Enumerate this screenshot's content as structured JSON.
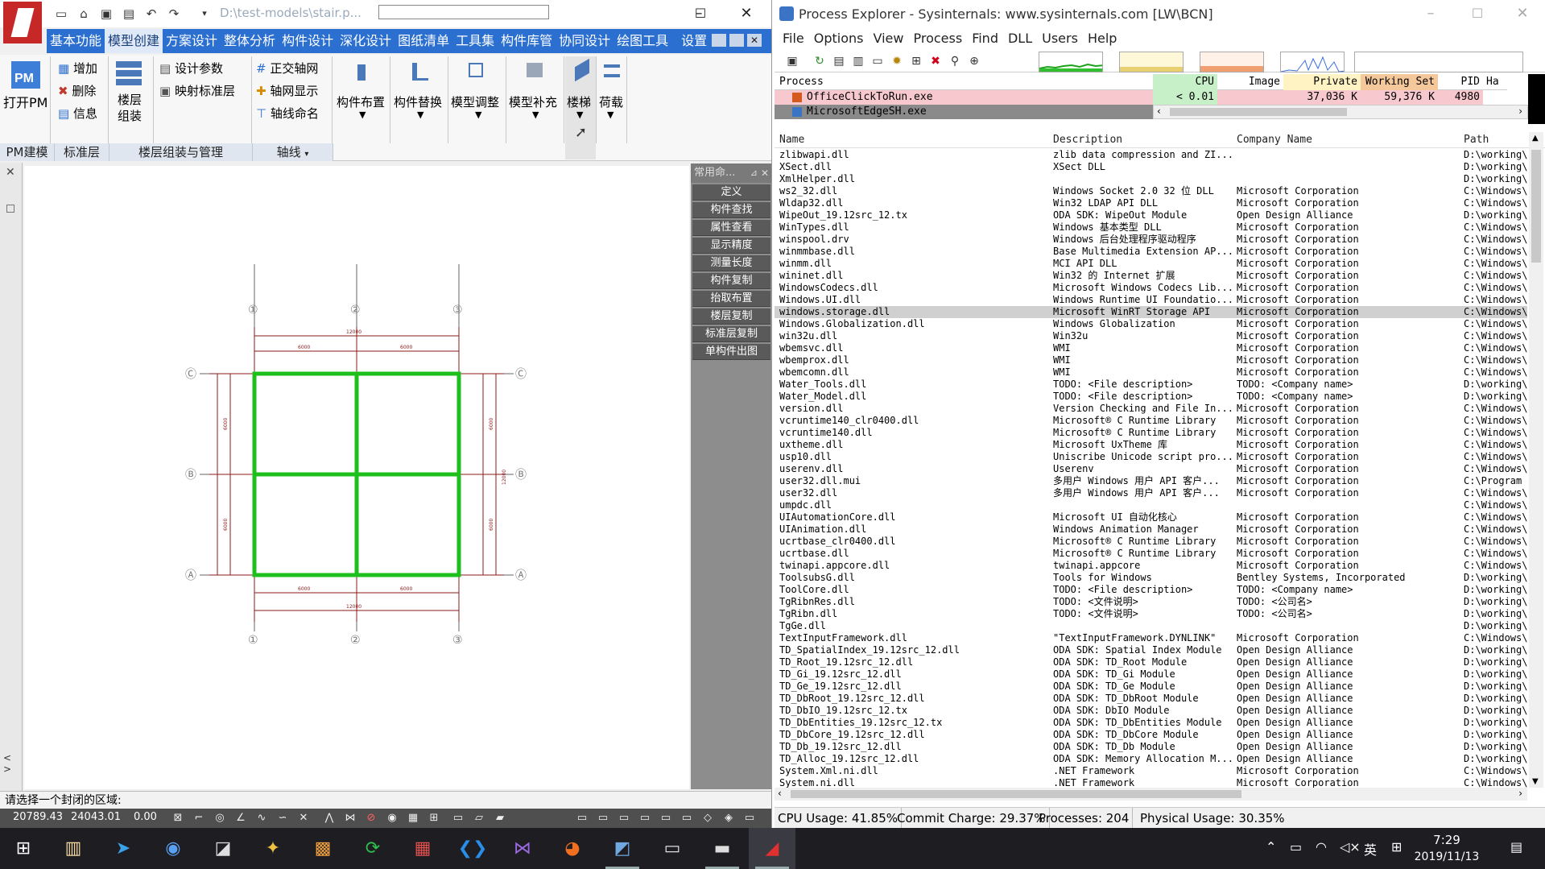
{
  "cad": {
    "path": "D:\\test-models\\stair.p...",
    "menu": [
      "基本功能",
      "模型创建",
      "方案设计",
      "整体分析",
      "构件设计",
      "深化设计",
      "图纸清单",
      "工具集",
      "构件库管",
      "协同设计",
      "绘图工具",
      "设置"
    ],
    "ribbon": {
      "open_pm": "打开PM",
      "add": "增加",
      "delete": "删除",
      "info": "信息",
      "floor_assembly": "楼层组装",
      "design_params": "设计参数",
      "map_standard_floor": "映射标准层",
      "ortho_grid": "正交轴网",
      "grid_display": "轴网显示",
      "grid_naming": "轴线命名",
      "member_layout": "构件布置",
      "member_replace": "构件替换",
      "model_adjust": "模型调整",
      "model_supplement": "模型补充",
      "stairs": "楼梯",
      "load": "荷载"
    },
    "groups": [
      "PM建模",
      "标准层",
      "楼层组装与管理",
      "轴线"
    ],
    "command_panel": {
      "title": "常用命...",
      "items": [
        "定义",
        "构件查找",
        "属性查看",
        "显示精度",
        "测量长度",
        "构件复制",
        "抬取布置",
        "楼层复制",
        "标准层复制",
        "单构件出图"
      ]
    },
    "drawing": {
      "top_labels": [
        "①",
        "②",
        "③"
      ],
      "side_labels": [
        "Ⓒ",
        "Ⓑ",
        "Ⓐ"
      ],
      "dim_seg": "6000",
      "dim_total": "12000"
    },
    "command_line": "请选择一个封闭的区域:",
    "coords": [
      "20789.43",
      "24043.01",
      "0.00"
    ]
  },
  "pe": {
    "title": "Process Explorer - Sysinternals: www.sysinternals.com [LW\\BCN]",
    "menu": [
      "File",
      "Options",
      "View",
      "Process",
      "Find",
      "DLL",
      "Users",
      "Help"
    ],
    "proc_headers": [
      "Process",
      "CPU",
      "Image Type",
      "Private Bytes",
      "Working Set",
      "PID",
      "Ha"
    ],
    "processes": [
      {
        "name": "OfficeClickToRun.exe",
        "cpu": "< 0.01",
        "private": "37,036 K",
        "working": "59,376 K",
        "pid": "4980"
      },
      {
        "name": "MicrosoftEdgeSH.exe",
        "cpu": "",
        "private": "",
        "working": "",
        "pid": ""
      }
    ],
    "dll_headers": [
      "Name",
      "Description",
      "Company Name",
      "Path"
    ],
    "dlls": [
      [
        "zlibwapi.dll",
        "zlib data compression and ZI...",
        "",
        "D:\\working\\"
      ],
      [
        "XSect.dll",
        "XSect DLL",
        "",
        "D:\\working\\"
      ],
      [
        "XmlHelper.dll",
        "",
        "",
        "D:\\working\\"
      ],
      [
        "ws2_32.dll",
        "Windows Socket 2.0 32 位 DLL",
        "Microsoft Corporation",
        "C:\\Windows\\"
      ],
      [
        "Wldap32.dll",
        "Win32 LDAP API DLL",
        "Microsoft Corporation",
        "C:\\Windows\\"
      ],
      [
        "WipeOut_19.12src_12.tx",
        "ODA SDK: WipeOut Module",
        "Open Design Alliance",
        "D:\\working\\"
      ],
      [
        "WinTypes.dll",
        "Windows 基本类型 DLL",
        "Microsoft Corporation",
        "C:\\Windows\\"
      ],
      [
        "winspool.drv",
        "Windows 后台处理程序驱动程序",
        "Microsoft Corporation",
        "C:\\Windows\\"
      ],
      [
        "winmmbase.dll",
        "Base Multimedia Extension AP...",
        "Microsoft Corporation",
        "C:\\Windows\\"
      ],
      [
        "winmm.dll",
        "MCI API DLL",
        "Microsoft Corporation",
        "C:\\Windows\\"
      ],
      [
        "wininet.dll",
        "Win32 的 Internet 扩展",
        "Microsoft Corporation",
        "C:\\Windows\\"
      ],
      [
        "WindowsCodecs.dll",
        "Microsoft Windows Codecs Lib...",
        "Microsoft Corporation",
        "C:\\Windows\\"
      ],
      [
        "Windows.UI.dll",
        "Windows Runtime UI Foundatio...",
        "Microsoft Corporation",
        "C:\\Windows\\"
      ],
      [
        "windows.storage.dll",
        "Microsoft WinRT Storage API",
        "Microsoft Corporation",
        "C:\\Windows\\"
      ],
      [
        "Windows.Globalization.dll",
        "Windows Globalization",
        "Microsoft Corporation",
        "C:\\Windows\\"
      ],
      [
        "win32u.dll",
        "Win32u",
        "Microsoft Corporation",
        "C:\\Windows\\"
      ],
      [
        "wbemsvc.dll",
        "WMI",
        "Microsoft Corporation",
        "C:\\Windows\\"
      ],
      [
        "wbemprox.dll",
        "WMI",
        "Microsoft Corporation",
        "C:\\Windows\\"
      ],
      [
        "wbemcomn.dll",
        "WMI",
        "Microsoft Corporation",
        "C:\\Windows\\"
      ],
      [
        "Water_Tools.dll",
        "TODO: <File description>",
        "TODO: <Company name>",
        "D:\\working\\"
      ],
      [
        "Water_Model.dll",
        "TODO: <File description>",
        "TODO: <Company name>",
        "D:\\working\\"
      ],
      [
        "version.dll",
        "Version Checking and File In...",
        "Microsoft Corporation",
        "C:\\Windows\\"
      ],
      [
        "vcruntime140_clr0400.dll",
        "Microsoft® C Runtime Library",
        "Microsoft Corporation",
        "C:\\Windows\\"
      ],
      [
        "vcruntime140.dll",
        "Microsoft® C Runtime Library",
        "Microsoft Corporation",
        "C:\\Windows\\"
      ],
      [
        "uxtheme.dll",
        "Microsoft UxTheme 库",
        "Microsoft Corporation",
        "C:\\Windows\\"
      ],
      [
        "usp10.dll",
        "Uniscribe Unicode script pro...",
        "Microsoft Corporation",
        "C:\\Windows\\"
      ],
      [
        "userenv.dll",
        "Userenv",
        "Microsoft Corporation",
        "C:\\Windows\\"
      ],
      [
        "user32.dll.mui",
        "多用户 Windows 用户 API 客户...",
        "Microsoft Corporation",
        "C:\\Program"
      ],
      [
        "user32.dll",
        "多用户 Windows 用户 API 客户...",
        "Microsoft Corporation",
        "C:\\Windows\\"
      ],
      [
        "umpdc.dll",
        "",
        "",
        "C:\\Windows\\"
      ],
      [
        "UIAutomationCore.dll",
        "Microsoft UI 自动化核心",
        "Microsoft Corporation",
        "C:\\Windows\\"
      ],
      [
        "UIAnimation.dll",
        "Windows Animation Manager",
        "Microsoft Corporation",
        "C:\\Windows\\"
      ],
      [
        "ucrtbase_clr0400.dll",
        "Microsoft® C Runtime Library",
        "Microsoft Corporation",
        "C:\\Windows\\"
      ],
      [
        "ucrtbase.dll",
        "Microsoft® C Runtime Library",
        "Microsoft Corporation",
        "C:\\Windows\\"
      ],
      [
        "twinapi.appcore.dll",
        "twinapi.appcore",
        "Microsoft Corporation",
        "C:\\Windows\\"
      ],
      [
        "ToolsubsG.dll",
        "Tools for Windows",
        "Bentley Systems, Incorporated",
        "D:\\working\\"
      ],
      [
        "ToolCore.dll",
        "TODO: <File description>",
        "TODO: <Company name>",
        "D:\\working\\"
      ],
      [
        "TgRibnRes.dll",
        "TODO: <文件说明>",
        "TODO: <公司名>",
        "D:\\working\\"
      ],
      [
        "TgRibn.dll",
        "TODO: <文件说明>",
        "TODO: <公司名>",
        "D:\\working\\"
      ],
      [
        "TgGe.dll",
        "",
        "",
        "D:\\working\\"
      ],
      [
        "TextInputFramework.dll",
        "\"TextInputFramework.DYNLINK\"",
        "Microsoft Corporation",
        "C:\\Windows\\"
      ],
      [
        "TD_SpatialIndex_19.12src_12.dll",
        "ODA SDK: Spatial Index Module",
        "Open Design Alliance",
        "D:\\working\\"
      ],
      [
        "TD_Root_19.12src_12.dll",
        "ODA SDK: TD_Root Module",
        "Open Design Alliance",
        "D:\\working\\"
      ],
      [
        "TD_Gi_19.12src_12.dll",
        "ODA SDK: TD_Gi Module",
        "Open Design Alliance",
        "D:\\working\\"
      ],
      [
        "TD_Ge_19.12src_12.dll",
        "ODA SDK: TD_Ge Module",
        "Open Design Alliance",
        "D:\\working\\"
      ],
      [
        "TD_DbRoot_19.12src_12.dll",
        "ODA SDK: TD_DbRoot Module",
        "Open Design Alliance",
        "D:\\working\\"
      ],
      [
        "TD_DbIO_19.12src_12.tx",
        "ODA SDK: DbIO Module",
        "Open Design Alliance",
        "D:\\working\\"
      ],
      [
        "TD_DbEntities_19.12src_12.tx",
        "ODA SDK: TD_DbEntities Module",
        "Open Design Alliance",
        "D:\\working\\"
      ],
      [
        "TD_DbCore_19.12src_12.dll",
        "ODA SDK: TD_DbCore Module",
        "Open Design Alliance",
        "D:\\working\\"
      ],
      [
        "TD_Db_19.12src_12.dll",
        "ODA SDK: TD_Db Module",
        "Open Design Alliance",
        "D:\\working\\"
      ],
      [
        "TD_Alloc_19.12src_12.dll",
        "ODA SDK: Memory Allocation M...",
        "Open Design Alliance",
        "D:\\working\\"
      ],
      [
        "System.Xml.ni.dll",
        ".NET Framework",
        "Microsoft Corporation",
        "C:\\Windows\\"
      ],
      [
        "System.ni.dll",
        ".NET Framework",
        "Microsoft Corporation",
        "C:\\Windows\\"
      ]
    ],
    "selected_dll": "windows.storage.dll",
    "status": [
      "CPU Usage: 41.85%",
      "Commit Charge: 29.37%",
      "Processes: 204",
      "Physical Usage: 30.35%"
    ]
  },
  "taskbar": {
    "ime": "英",
    "time": "7:29",
    "date": "2019/11/13"
  },
  "colors": {
    "ribbon_blue": "#2b6fd1",
    "beam_green": "#1dbf1d",
    "dim_red": "#8b1a1a",
    "pe_cpu_green": "#c8f0c8",
    "pe_ws_orange": "#f4c89a",
    "pe_row_pink": "#f7c9cf"
  }
}
